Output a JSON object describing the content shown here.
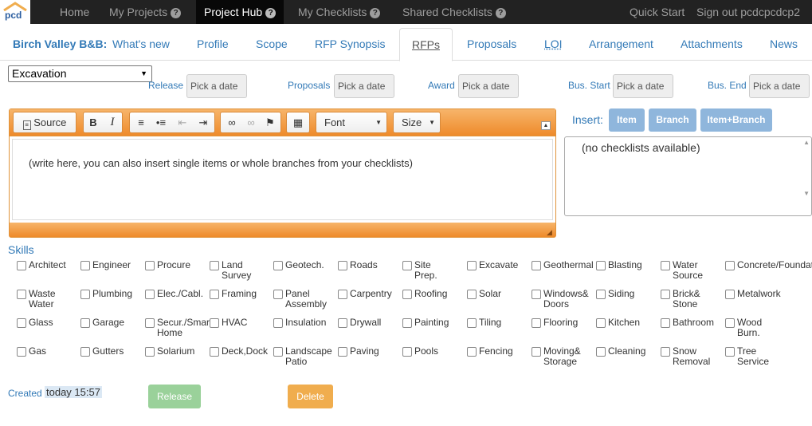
{
  "logo_text": "pcd",
  "nav": {
    "home": "Home",
    "my_projects": "My Projects",
    "project_hub": "Project Hub",
    "my_checklists": "My Checklists",
    "shared_checklists": "Shared Checklists",
    "quick_start": "Quick Start",
    "sign_out": "Sign out pcdcpcdcp2",
    "help_glyph": "?"
  },
  "tabs": {
    "brand": "Birch Valley B&B:",
    "whats_new": "What's new",
    "profile": "Profile",
    "scope": "Scope",
    "rfp_synopsis": "RFP Synopsis",
    "rfps": "RFPs",
    "proposals": "Proposals",
    "loi": "LOI",
    "arrangement": "Arrangement",
    "attachments": "Attachments",
    "news": "News"
  },
  "category_select": {
    "value": "Excavation"
  },
  "dates": {
    "release": "Release",
    "proposals": "Proposals",
    "award": "Award",
    "bus_start": "Bus. Start",
    "bus_end": "Bus. End",
    "placeholder": "Pick a date"
  },
  "editor": {
    "source": "Source",
    "bold": "B",
    "italic": "I",
    "font": "Font",
    "size": "Size",
    "content": "(write here, you can also insert single items or whole branches from your checklists)"
  },
  "insert": {
    "label": "Insert:",
    "item": "Item",
    "branch": "Branch",
    "item_branch": "Item+Branch",
    "empty": "(no checklists available)"
  },
  "skills": {
    "title": "Skills",
    "rows": [
      [
        {
          "l1": "Architect",
          "l2": ""
        },
        {
          "l1": "Engineer",
          "l2": ""
        },
        {
          "l1": "Procure",
          "l2": ""
        },
        {
          "l1": "Land",
          "l2": "Survey"
        },
        {
          "l1": "Geotech.",
          "l2": ""
        },
        {
          "l1": "Roads",
          "l2": ""
        },
        {
          "l1": "Site",
          "l2": "Prep."
        },
        {
          "l1": "Excavate",
          "l2": ""
        },
        {
          "l1": "Geothermal",
          "l2": ""
        },
        {
          "l1": "Blasting",
          "l2": ""
        },
        {
          "l1": "Water",
          "l2": "Source"
        },
        {
          "l1": "Concrete/Foundat",
          "l2": ""
        }
      ],
      [
        {
          "l1": "Waste",
          "l2": "Water"
        },
        {
          "l1": "Plumbing",
          "l2": ""
        },
        {
          "l1": "Elec./Cabl.",
          "l2": ""
        },
        {
          "l1": "Framing",
          "l2": ""
        },
        {
          "l1": "Panel",
          "l2": "Assembly"
        },
        {
          "l1": "Carpentry",
          "l2": ""
        },
        {
          "l1": "Roofing",
          "l2": ""
        },
        {
          "l1": "Solar",
          "l2": ""
        },
        {
          "l1": "Windows&",
          "l2": "Doors"
        },
        {
          "l1": "Siding",
          "l2": ""
        },
        {
          "l1": "Brick&",
          "l2": "Stone"
        },
        {
          "l1": "Metalwork",
          "l2": ""
        }
      ],
      [
        {
          "l1": "Glass",
          "l2": ""
        },
        {
          "l1": "Garage",
          "l2": ""
        },
        {
          "l1": "Secur./Smar",
          "l2": "Home"
        },
        {
          "l1": "HVAC",
          "l2": ""
        },
        {
          "l1": "Insulation",
          "l2": ""
        },
        {
          "l1": "Drywall",
          "l2": ""
        },
        {
          "l1": "Painting",
          "l2": ""
        },
        {
          "l1": "Tiling",
          "l2": ""
        },
        {
          "l1": "Flooring",
          "l2": ""
        },
        {
          "l1": "Kitchen",
          "l2": ""
        },
        {
          "l1": "Bathroom",
          "l2": ""
        },
        {
          "l1": "Wood",
          "l2": "Burn."
        }
      ],
      [
        {
          "l1": "Gas",
          "l2": ""
        },
        {
          "l1": "Gutters",
          "l2": ""
        },
        {
          "l1": "Solarium",
          "l2": ""
        },
        {
          "l1": "Deck,Dock",
          "l2": ""
        },
        {
          "l1": "Landscape",
          "l2": "Patio"
        },
        {
          "l1": "Paving",
          "l2": ""
        },
        {
          "l1": "Pools",
          "l2": ""
        },
        {
          "l1": "Fencing",
          "l2": ""
        },
        {
          "l1": "Moving&",
          "l2": "Storage"
        },
        {
          "l1": "Cleaning",
          "l2": ""
        },
        {
          "l1": "Snow",
          "l2": "Removal"
        },
        {
          "l1": "Tree",
          "l2": "Service"
        }
      ]
    ]
  },
  "footer": {
    "created_label": "Created",
    "created_value": "today 15:57",
    "release": "Release",
    "delete": "Delete"
  },
  "colors": {
    "nav_bg": "#222222",
    "link": "#337ab7",
    "editor_orange": "#ee8a2a",
    "insert_button": "#8fb6dc",
    "release_button": "#9ad19a",
    "delete_button": "#f0ad4e"
  }
}
